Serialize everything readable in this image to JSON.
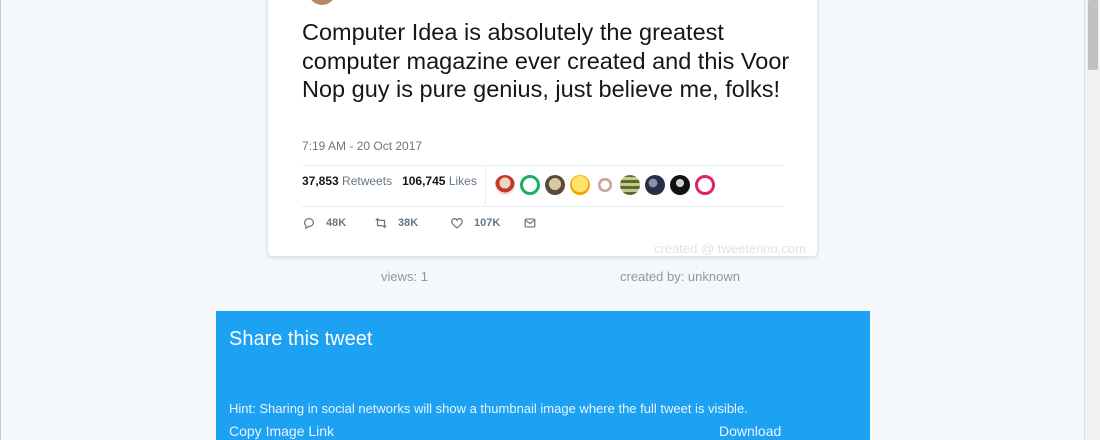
{
  "tweet": {
    "text": "Computer Idea is absolutely the greatest computer magazine ever created and this Voor Nop guy is pure genius, just believe me, folks!",
    "timestamp": "7:19 AM - 20 Oct 2017",
    "retweets_count": "37,853",
    "retweets_label": "Retweets",
    "likes_count": "106,745",
    "likes_label": "Likes",
    "actions": {
      "reply_count": "48K",
      "retweet_count": "38K",
      "like_count": "107K"
    },
    "watermark": "created @ tweeterino.com"
  },
  "meta": {
    "views": "views: 1",
    "created_by": "created by: unknown"
  },
  "share": {
    "title": "Share this tweet",
    "hint": "Hint: Sharing in social networks will show a thumbnail image where the full tweet is visible.",
    "copy_link": "Copy Image Link",
    "download": "Download"
  },
  "colors": {
    "accent": "#1da1f2",
    "text": "#14171a",
    "muted": "#657786"
  },
  "icons": [
    "reply-icon",
    "retweet-icon",
    "like-icon",
    "message-icon"
  ]
}
